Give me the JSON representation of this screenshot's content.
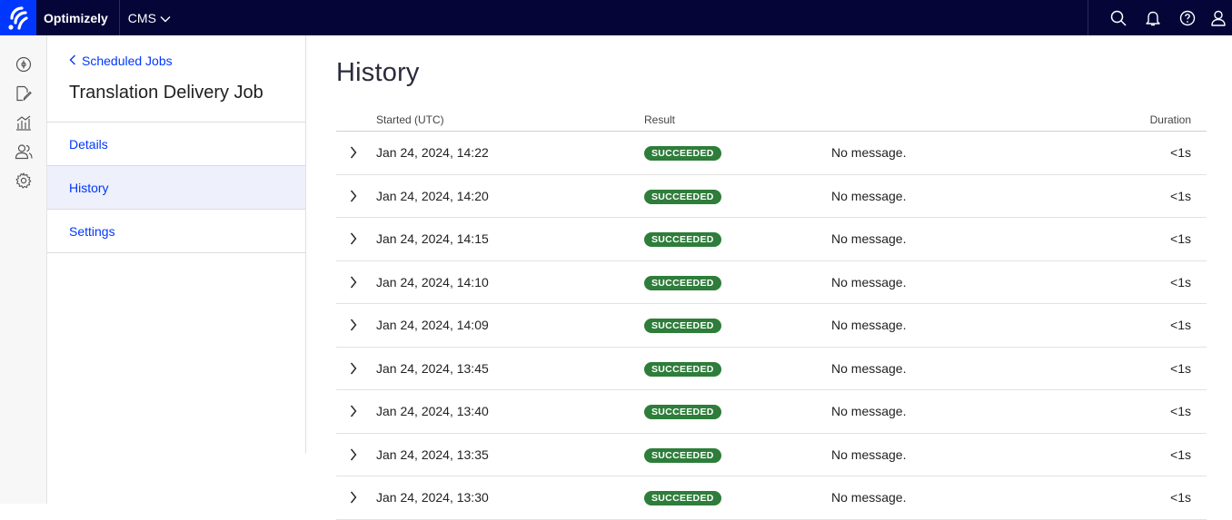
{
  "topbar": {
    "brand": "Optimizely",
    "product": "CMS",
    "icons": [
      "search-icon",
      "bell-icon",
      "help-icon",
      "user-icon"
    ]
  },
  "leftnav": {
    "icons": [
      "compass-icon",
      "edit-document-icon",
      "analytics-icon",
      "users-icon",
      "gear-icon"
    ]
  },
  "subnav": {
    "back_label": "Scheduled Jobs",
    "job_title": "Translation Delivery Job",
    "items": [
      {
        "label": "Details",
        "active": false
      },
      {
        "label": "History",
        "active": true
      },
      {
        "label": "Settings",
        "active": false
      }
    ]
  },
  "main": {
    "title": "History",
    "columns": {
      "started": "Started (UTC)",
      "result": "Result",
      "duration": "Duration"
    },
    "rows": [
      {
        "started": "Jan 24, 2024, 14:22",
        "result": "SUCCEEDED",
        "message": "No message.",
        "duration": "<1s"
      },
      {
        "started": "Jan 24, 2024, 14:20",
        "result": "SUCCEEDED",
        "message": "No message.",
        "duration": "<1s"
      },
      {
        "started": "Jan 24, 2024, 14:15",
        "result": "SUCCEEDED",
        "message": "No message.",
        "duration": "<1s"
      },
      {
        "started": "Jan 24, 2024, 14:10",
        "result": "SUCCEEDED",
        "message": "No message.",
        "duration": "<1s"
      },
      {
        "started": "Jan 24, 2024, 14:09",
        "result": "SUCCEEDED",
        "message": "No message.",
        "duration": "<1s"
      },
      {
        "started": "Jan 24, 2024, 13:45",
        "result": "SUCCEEDED",
        "message": "No message.",
        "duration": "<1s"
      },
      {
        "started": "Jan 24, 2024, 13:40",
        "result": "SUCCEEDED",
        "message": "No message.",
        "duration": "<1s"
      },
      {
        "started": "Jan 24, 2024, 13:35",
        "result": "SUCCEEDED",
        "message": "No message.",
        "duration": "<1s"
      },
      {
        "started": "Jan 24, 2024, 13:30",
        "result": "SUCCEEDED",
        "message": "No message.",
        "duration": "<1s"
      }
    ]
  },
  "colors": {
    "topbar_bg": "#050538",
    "logo_bg": "#0037ff",
    "link": "#0037ff",
    "success_badge": "#2e7d3a",
    "active_item_bg": "#eef0fb"
  }
}
